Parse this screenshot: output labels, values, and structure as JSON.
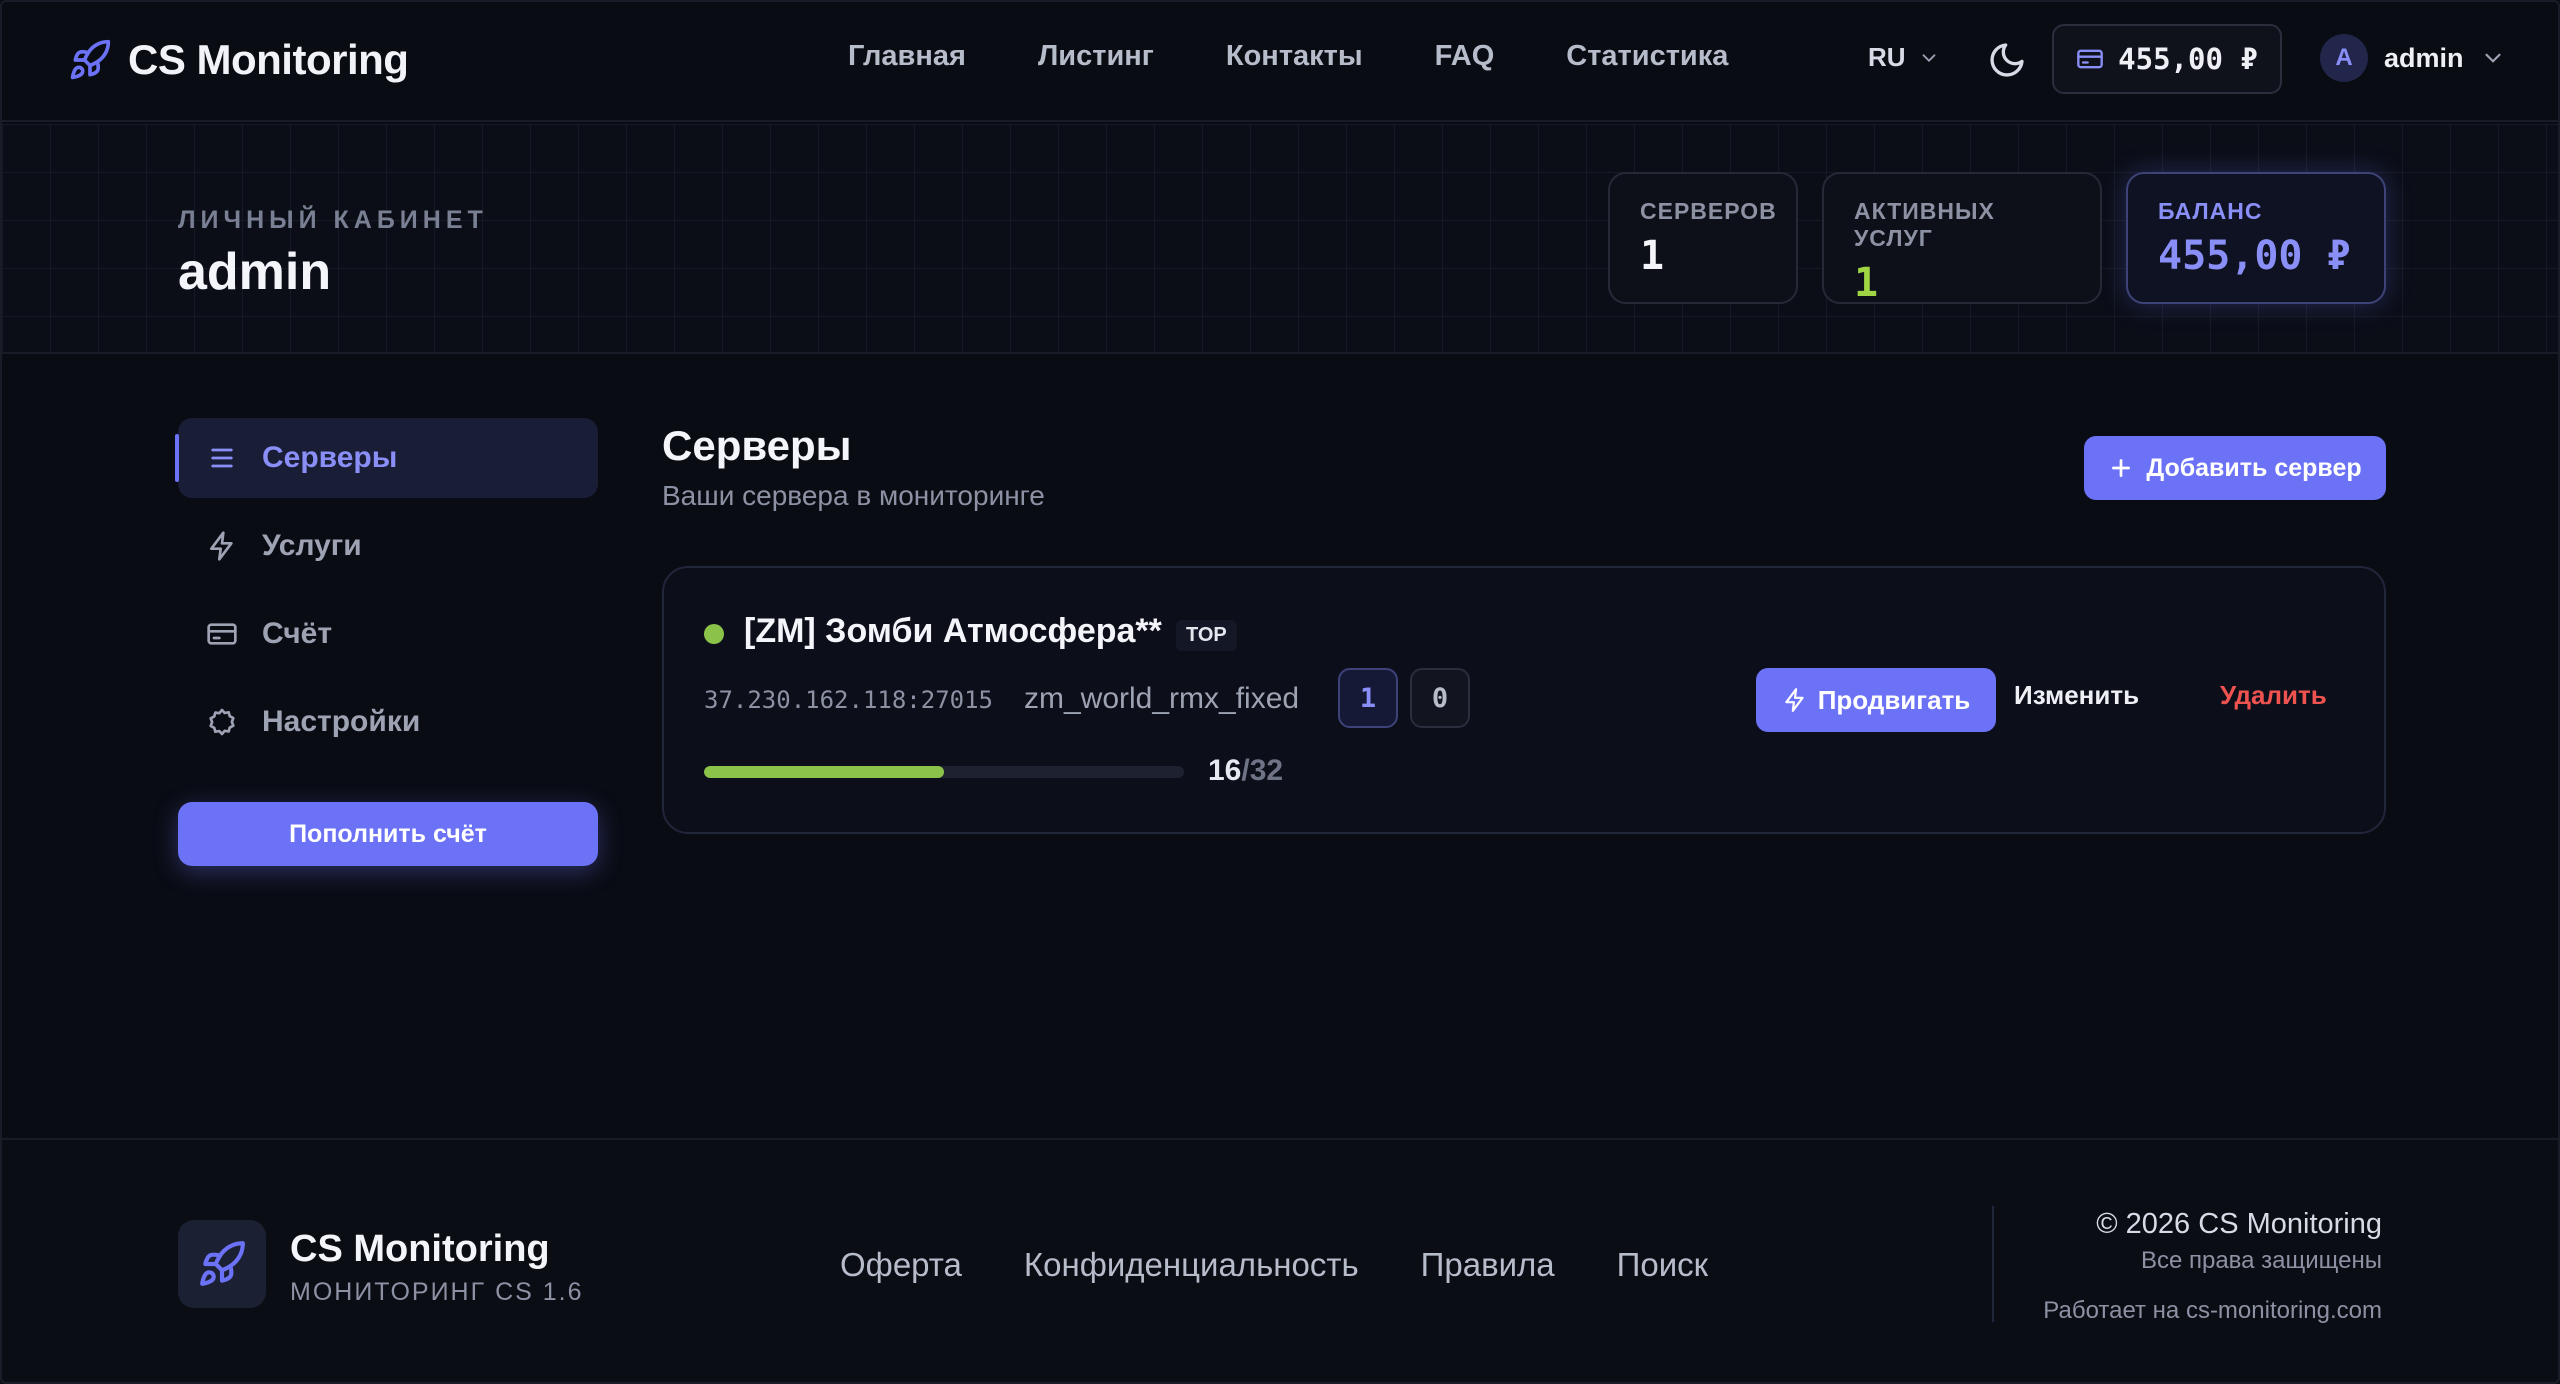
{
  "header": {
    "brand": "CS Monitoring",
    "nav": [
      "Главная",
      "Листинг",
      "Контакты",
      "FAQ",
      "Статистика"
    ],
    "lang": "RU",
    "wallet_balance": "455,00 ₽",
    "avatar_letter": "A",
    "username": "admin"
  },
  "hero": {
    "label": "ЛИЧНЫЙ КАБИНЕТ",
    "name": "admin",
    "stats": {
      "servers_label": "СЕРВЕРОВ",
      "servers_value": "1",
      "services_label": "АКТИВНЫХ УСЛУГ",
      "services_value": "1",
      "balance_label": "БАЛАНС",
      "balance_value": "455,00 ₽"
    }
  },
  "sidebar": {
    "items": [
      "Серверы",
      "Услуги",
      "Счёт",
      "Настройки"
    ],
    "topup": "Пополнить счёт"
  },
  "main": {
    "title": "Серверы",
    "subtitle": "Ваши сервера в мониторинге",
    "add_button": "Добавить сервер",
    "server": {
      "name": "[ZM] Зомби Атмосфера**",
      "badge": "TOP",
      "address": "37.230.162.118:27015",
      "map": "zm_world_rmx_fixed",
      "chip_a": "1",
      "chip_b": "0",
      "players_current": "16",
      "players_max": "/32",
      "load_fraction": 0.5,
      "promote": "Продвигать",
      "edit": "Изменить",
      "delete": "Удалить"
    }
  },
  "footer": {
    "brand": "CS Monitoring",
    "tagline": "МОНИТОРИНГ CS 1.6",
    "links": [
      "Оферта",
      "Конфиденциальность",
      "Правила",
      "Поиск"
    ],
    "copyright": "© 2026 CS Monitoring",
    "rights": "Все права защищены",
    "powered": "Работает на cs-monitoring.com"
  },
  "colors": {
    "accent": "#6c72f5",
    "online": "#8bc34a",
    "danger": "#ef5350",
    "background": "#0a0c14"
  }
}
